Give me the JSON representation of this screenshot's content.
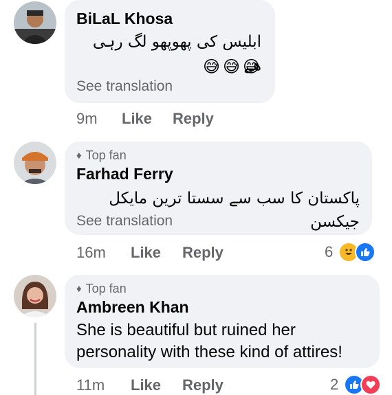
{
  "comments": [
    {
      "author": "BiLaL Khosa",
      "text": "ابلیس کی پھوپھو لگ رہی ھے",
      "emoji": "😅😅😅",
      "see_translation": "See translation",
      "time": "9m",
      "like": "Like",
      "reply": "Reply"
    },
    {
      "badge": "Top fan",
      "author": "Farhad Ferry",
      "text": "پاکستان کا سب سے سستا ترین مایکل جیکسن",
      "see_translation": "See translation",
      "time": "16m",
      "like": "Like",
      "reply": "Reply",
      "reaction_count": "6",
      "reactions": [
        "haha-icon",
        "like-icon"
      ]
    },
    {
      "badge": "Top fan",
      "author": "Ambreen Khan",
      "text_line1": "She is beautiful but ruined her",
      "text_line2": "personality with these kind of attires!",
      "time": "11m",
      "like": "Like",
      "reply": "Reply",
      "reaction_count": "2",
      "reactions": [
        "like-icon",
        "love-icon"
      ]
    }
  ],
  "colors": {
    "bubble": "#f0f2f5",
    "secondary_text": "#65676b",
    "like_blue": "#1877f2",
    "love_red": "#f33e58",
    "haha_yellow": "#f7b928"
  }
}
